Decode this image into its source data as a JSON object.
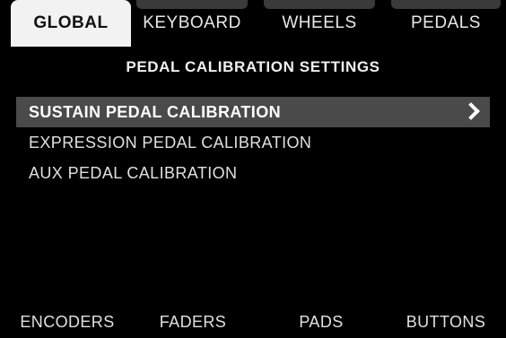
{
  "tabs": [
    {
      "label": "GLOBAL",
      "active": true
    },
    {
      "label": "KEYBOARD",
      "active": false
    },
    {
      "label": "WHEELS",
      "active": false
    },
    {
      "label": "PEDALS",
      "active": false
    }
  ],
  "page_title": "PEDAL CALIBRATION SETTINGS",
  "menu": {
    "items": [
      {
        "label": "SUSTAIN PEDAL CALIBRATION",
        "selected": true,
        "icon": "chevron-right-icon"
      },
      {
        "label": "EXPRESSION PEDAL CALIBRATION",
        "selected": false
      },
      {
        "label": "AUX PEDAL CALIBRATION",
        "selected": false
      }
    ]
  },
  "softkeys": [
    {
      "label": "ENCODERS"
    },
    {
      "label": "FADERS"
    },
    {
      "label": "PADS"
    },
    {
      "label": "BUTTONS"
    }
  ],
  "colors": {
    "background": "#000000",
    "active_tab": "#f2f2f2",
    "selected_row": "#4a4a4a",
    "text": "#e0e0e0"
  }
}
